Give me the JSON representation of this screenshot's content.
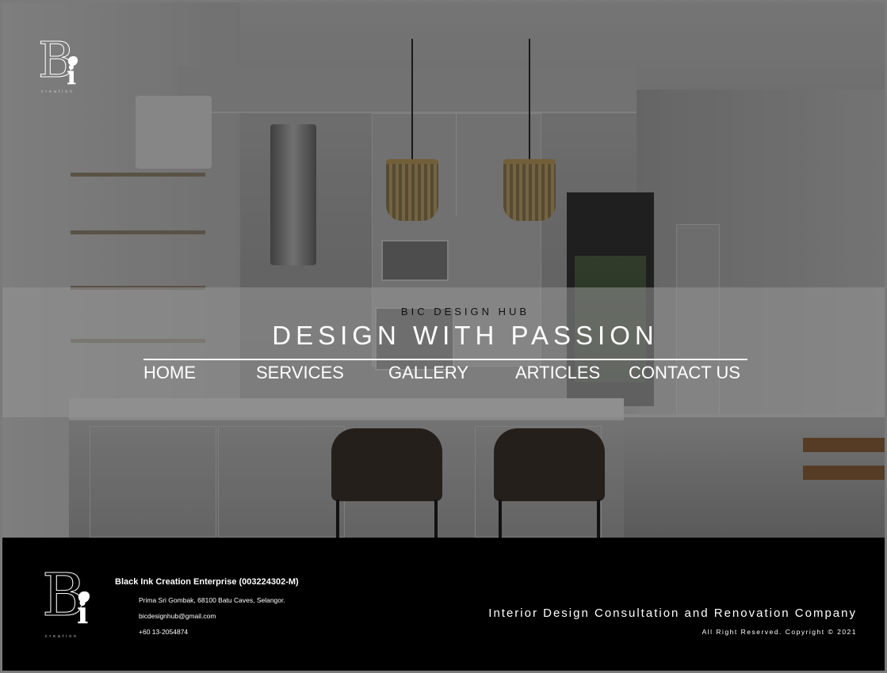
{
  "brand": {
    "logo_letters": "Bi",
    "logo_caption": "creation"
  },
  "hero": {
    "kicker": "BIC DESIGN HUB",
    "headline": "DESIGN WITH PASSION"
  },
  "nav": {
    "items": [
      {
        "label": "HOME"
      },
      {
        "label": "SERVICES"
      },
      {
        "label": "GALLERY"
      },
      {
        "label": "ARTICLES"
      },
      {
        "label": "CONTACT US"
      }
    ]
  },
  "footer": {
    "company": "Black Ink Creation Enterprise (003224302-M)",
    "address": "Prima Sri Gombak, 68100 Batu Caves, Selangor.",
    "email": "bicdesignhub@gmail.com",
    "phone": "+60 13-2054874",
    "tagline": "Interior Design Consultation and Renovation Company",
    "copyright": "All Right Reserved. Copyright © 2021"
  }
}
